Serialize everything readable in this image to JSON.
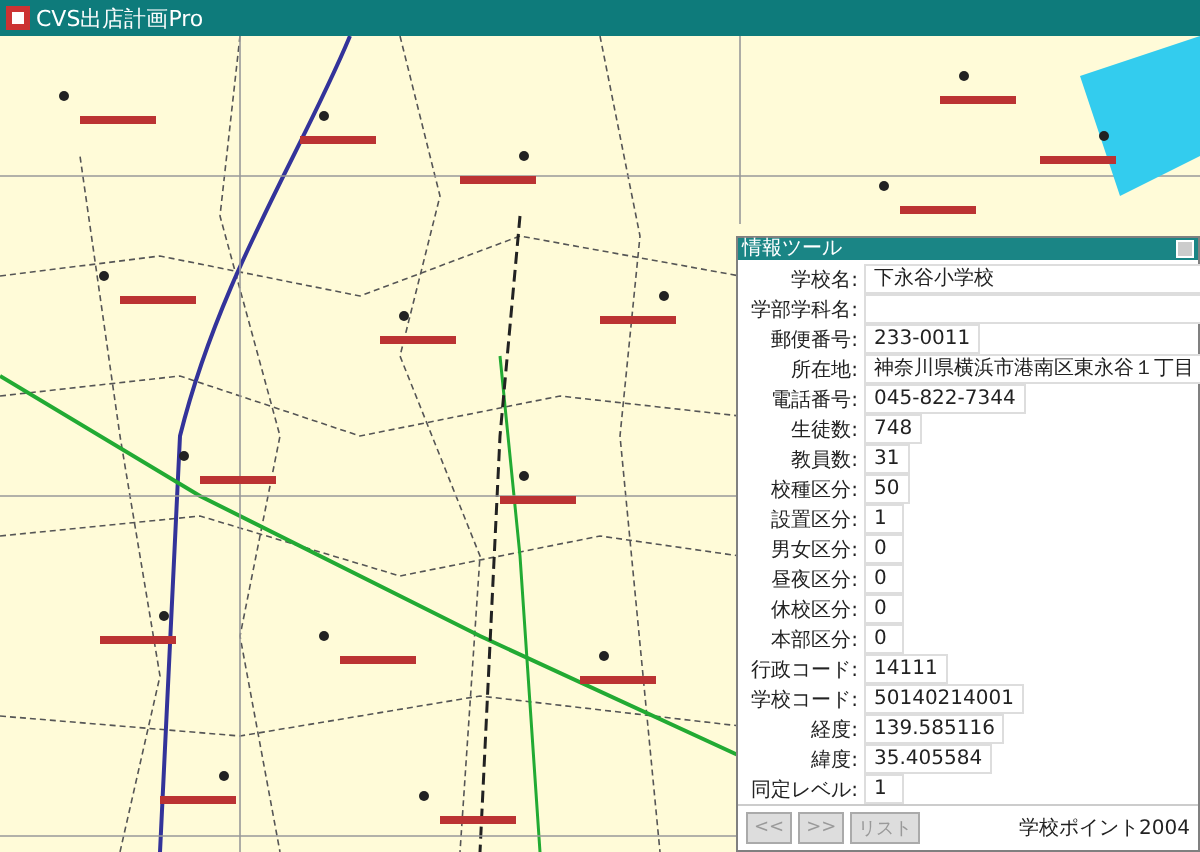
{
  "window": {
    "title": "CVS出店計画Pro"
  },
  "info_panel": {
    "title": "情報ツール",
    "fields": [
      {
        "label": "学校名:",
        "value": "下永谷小学校",
        "kind": "wide"
      },
      {
        "label": "学部学科名:",
        "kind": "wide"
      },
      {
        "label": "郵便番号:",
        "value": "233-0011",
        "kind": "fit"
      },
      {
        "label": "所在地:",
        "value": "神奈川県横浜市港南区東永谷１丁目",
        "kind": "wide"
      },
      {
        "label": "電話番号:",
        "value": "045-822-7344",
        "kind": "fit"
      },
      {
        "label": "生徒数:",
        "value": "748",
        "kind": "fit"
      },
      {
        "label": "教員数:",
        "value": "31",
        "kind": "fit"
      },
      {
        "label": "校種区分:",
        "value": "50",
        "kind": "fit"
      },
      {
        "label": "設置区分:",
        "value": "1",
        "kind": "fit"
      },
      {
        "label": "男女区分:",
        "value": "0",
        "kind": "fit"
      },
      {
        "label": "昼夜区分:",
        "value": "0",
        "kind": "fit"
      },
      {
        "label": "休校区分:",
        "value": "0",
        "kind": "fit"
      },
      {
        "label": "本部区分:",
        "value": "0",
        "kind": "fit"
      },
      {
        "label": "行政コード:",
        "value": "14111",
        "kind": "fit"
      },
      {
        "label": "学校コード:",
        "value": "50140214001",
        "kind": "fit"
      },
      {
        "label": "経度:",
        "value": "139.585116",
        "kind": "fit"
      },
      {
        "label": "緯度:",
        "value": "35.405584",
        "kind": "fit"
      },
      {
        "label": "同定レベル:",
        "value": "1",
        "kind": "fit"
      }
    ],
    "buttons": [
      {
        "label": "<<",
        "disabled": true
      },
      {
        "label": ">>",
        "disabled": true
      },
      {
        "label": "リスト",
        "disabled": true
      }
    ],
    "footer": "学校ポイント2004"
  }
}
